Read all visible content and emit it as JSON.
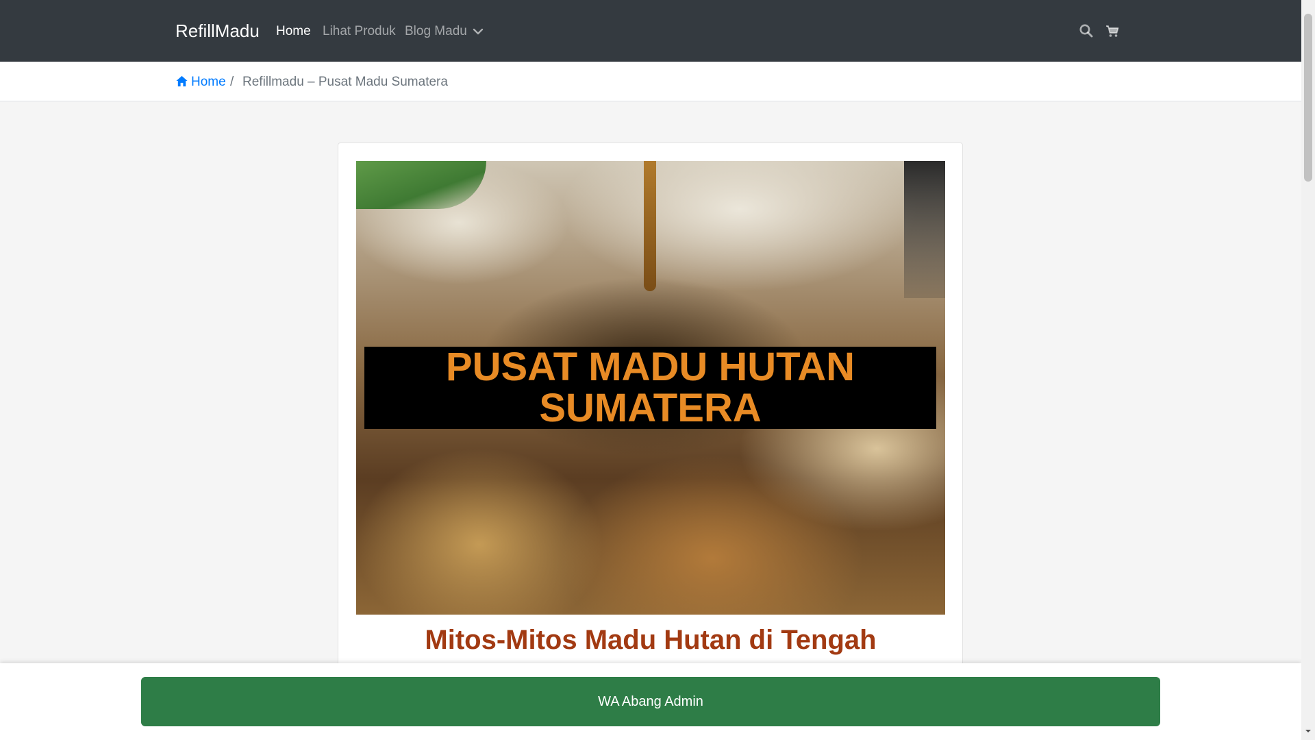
{
  "navbar": {
    "brand": "RefillMadu",
    "links": [
      {
        "label": "Home",
        "active": true
      },
      {
        "label": "Lihat Produk",
        "active": false
      },
      {
        "label": "Blog Madu",
        "active": false
      }
    ],
    "icons": [
      "search-icon",
      "cart-icon",
      "chevron-down-icon"
    ]
  },
  "breadcrumb": {
    "home": "Home",
    "separator": "/",
    "current": "Refillmadu – Pusat Madu Sumatera"
  },
  "hero": {
    "banner_line1": "PUSAT MADU HUTAN",
    "banner_line2": "SUMATERA"
  },
  "post": {
    "title": "Mitos-Mitos Madu Hutan di Tengah"
  },
  "footer": {
    "wa_button": "WA Abang Admin"
  },
  "colors": {
    "navbar_bg": "#343a40",
    "link_blue": "#007bff",
    "banner_text": "#e88b25",
    "title_red": "#a23a12",
    "wa_green": "#2e7d47"
  }
}
